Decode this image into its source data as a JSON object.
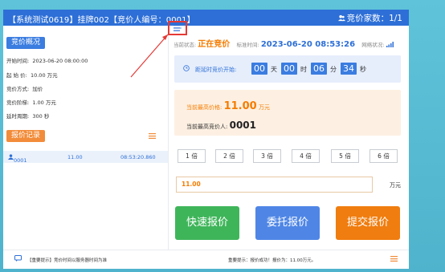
{
  "title": "【系统测试0619】挂牌002【竞价人编号：0001】",
  "bidder_count": "竞价家数：1/1",
  "left": {
    "overview_label": "竞价概况",
    "info": [
      {
        "label": "开始时间:",
        "value": "2023-06-20 08:00:00"
      },
      {
        "label": "起 始 价:",
        "value": "10.00 万元"
      },
      {
        "label": "竞价方式:",
        "value": "加价"
      },
      {
        "label": "竞价阶梯:",
        "value": "1.00 万元"
      },
      {
        "label": "延时周期:",
        "value": "300 秒"
      }
    ],
    "records_label": "报价记录",
    "records": [
      {
        "bidder": "0001",
        "price": "11.00",
        "time": "08:53:20.860"
      }
    ]
  },
  "status": {
    "state_label": "当前状态:",
    "state_value": "正在竞价",
    "time_label": "标准时间:",
    "time_value": "2023-06-20 08:53:26",
    "network_label": "网络状况:"
  },
  "countdown": {
    "label": "距延时竞价开始:",
    "days": "00",
    "days_unit": "天",
    "hours": "00",
    "hours_unit": "时",
    "minutes": "06",
    "minutes_unit": "分",
    "seconds": "34",
    "seconds_unit": "秒"
  },
  "highest": {
    "price_label": "当前最高价格:",
    "price": "11.00",
    "price_unit": "万元",
    "bidder_label": "当前最高竞价人:",
    "bidder": "0001"
  },
  "multipliers": [
    "1 倍",
    "2 倍",
    "3 倍",
    "4 倍",
    "5 倍",
    "6 倍"
  ],
  "price_input": {
    "value": "11.00",
    "unit": "万元"
  },
  "buttons": {
    "quick": "快速报价",
    "entrust": "委托报价",
    "submit": "提交报价"
  },
  "colors": {
    "quick": "#3fb55a",
    "entrust": "#4f86e6",
    "submit": "#f07d0f",
    "accent": "#2d6fd7"
  },
  "footer": {
    "notice_left": "【重要提示】竞价时间以服务器时间为准",
    "notice_right": "重要提示：报价成功！报价为：11.00万元。"
  }
}
